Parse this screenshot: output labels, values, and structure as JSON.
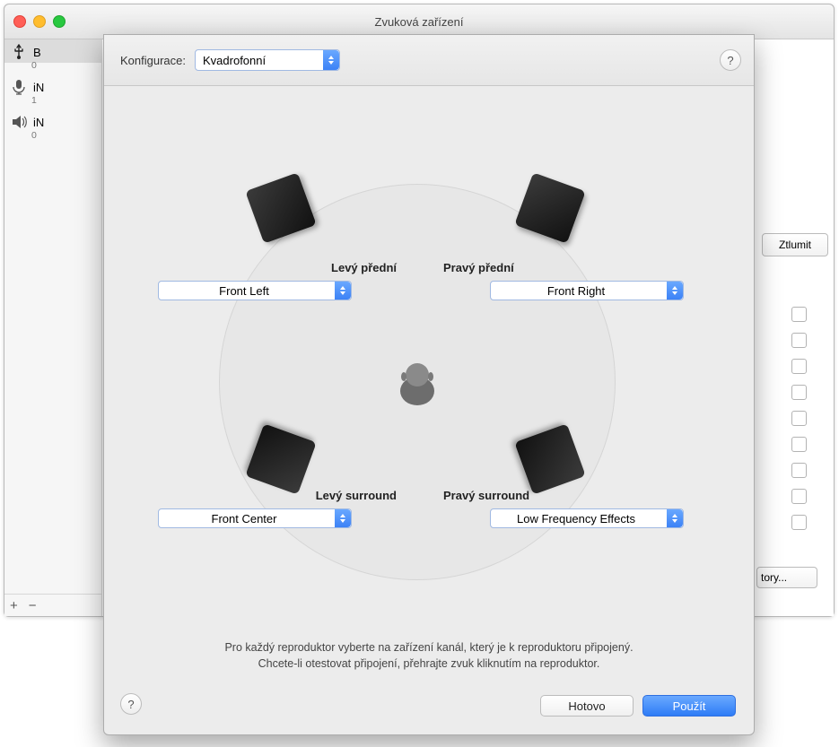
{
  "window": {
    "title": "Zvuková zařízení"
  },
  "sidebar": {
    "devices": [
      {
        "name": "B",
        "sub": "0",
        "icon": "usb"
      },
      {
        "name": "iN",
        "sub": "1",
        "icon": "mic"
      },
      {
        "name": "iN",
        "sub": "0",
        "icon": "speaker"
      }
    ],
    "add": "+",
    "remove": "−"
  },
  "background_panel": {
    "tab": "Ztlumit",
    "button_suffix": "tory..."
  },
  "sheet": {
    "config_label": "Konfigurace:",
    "config_value": "Kvadrofonní",
    "help": "?",
    "instructions_line1": "Pro každý reproduktor vyberte na zařízení kanál, který je k reproduktoru připojený.",
    "instructions_line2": "Chcete-li otestovat připojení, přehrajte zvuk kliknutím na reproduktor.",
    "done": "Hotovo",
    "apply": "Použít",
    "speakers": {
      "front_left": {
        "label": "Levý přední",
        "value": "Front Left"
      },
      "front_right": {
        "label": "Pravý přední",
        "value": "Front Right"
      },
      "rear_left": {
        "label": "Levý surround",
        "value": "Front Center"
      },
      "rear_right": {
        "label": "Pravý surround",
        "value": "Low Frequency Effects"
      }
    }
  }
}
